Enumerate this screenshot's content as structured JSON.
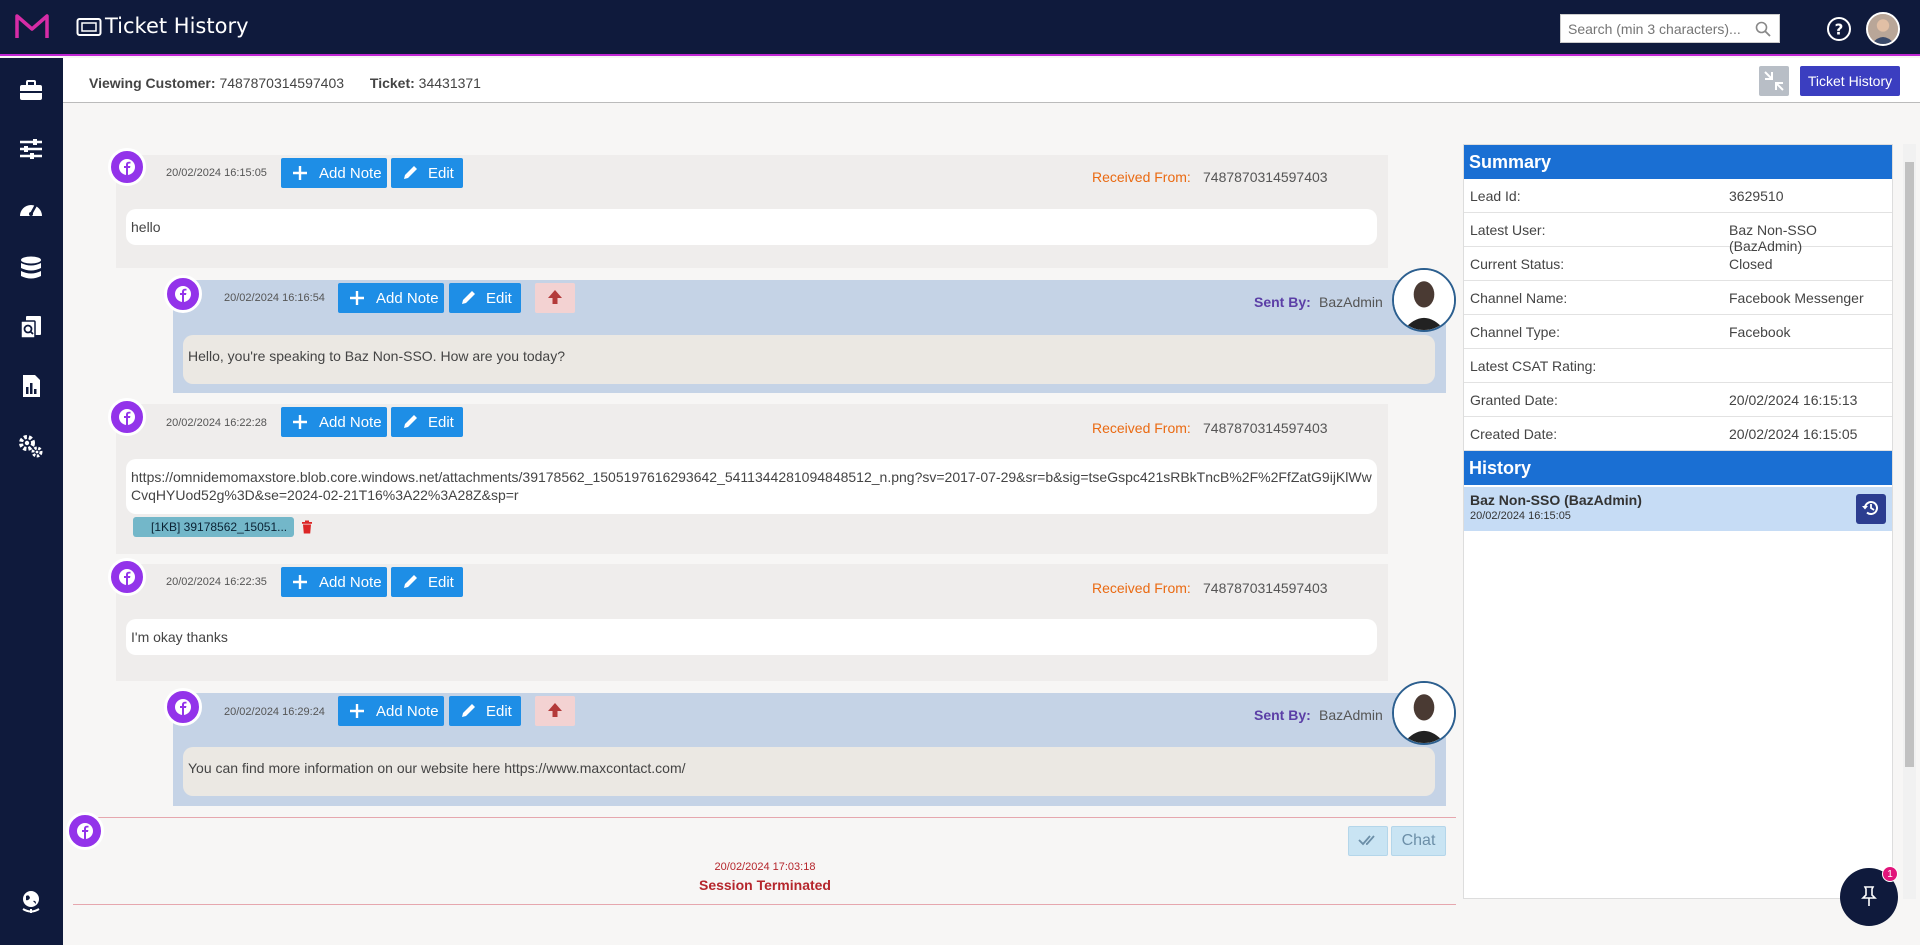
{
  "header": {
    "title": "Ticket History",
    "search_placeholder": "Search (min 3 characters)...",
    "icons": [
      "maxcontact-logo-icon",
      "ticket-icon",
      "search-icon",
      "help-icon",
      "avatar"
    ]
  },
  "sidebar": {
    "icons": [
      "briefcase-icon",
      "sliders-icon",
      "dashboard-icon",
      "database-icon",
      "documents-icon",
      "report-icon",
      "settings-icon",
      "globe-icon"
    ]
  },
  "subheader": {
    "viewing_label": "Viewing Customer:",
    "viewing_value": "7487870314597403",
    "ticket_label": "Ticket:",
    "ticket_value": "34431371",
    "ticket_history_button": "Ticket History"
  },
  "actions": {
    "add_note": "Add Note",
    "edit": "Edit"
  },
  "messages": [
    {
      "direction": "in",
      "timestamp": "20/02/2024 16:15:05",
      "from_label": "Received From:",
      "from_value": "7487870314597403",
      "text": "hello"
    },
    {
      "direction": "out",
      "timestamp": "20/02/2024 16:16:54",
      "from_label": "Sent By:",
      "from_value": "BazAdmin",
      "text": "Hello, you're speaking to Baz Non-SSO. How are you today?"
    },
    {
      "direction": "in",
      "timestamp": "20/02/2024 16:22:28",
      "from_label": "Received From:",
      "from_value": "7487870314597403",
      "text": "https://omnidemomaxstore.blob.core.windows.net/attachments/39178562_1505197616293642_5411344281094848512_n.png?sv=2017-07-29&sr=b&sig=tseGspc421sRBkTncB%2F%2FfZatG9ijKlWwCvqHYUod52g%3D&se=2024-02-21T16%3A22%3A28Z&sp=r",
      "attachment": "[1KB] 39178562_15051..."
    },
    {
      "direction": "in",
      "timestamp": "20/02/2024 16:22:35",
      "from_label": "Received From:",
      "from_value": "7487870314597403",
      "text": "I'm okay thanks"
    },
    {
      "direction": "out",
      "timestamp": "20/02/2024 16:29:24",
      "from_label": "Sent By:",
      "from_value": "BazAdmin",
      "text": "You can find more information on our website here https://www.maxcontact.com/"
    }
  ],
  "session": {
    "date": "20/02/2024 17:03:18",
    "status": "Session Terminated",
    "chat_button": "Chat"
  },
  "summary": {
    "title": "Summary",
    "rows": [
      {
        "key": "Lead Id:",
        "value": "3629510"
      },
      {
        "key": "Latest User:",
        "value": "Baz Non-SSO (BazAdmin)"
      },
      {
        "key": "Current Status:",
        "value": "Closed"
      },
      {
        "key": "Channel Name:",
        "value": "Facebook Messenger"
      },
      {
        "key": "Channel Type:",
        "value": "Facebook"
      },
      {
        "key": "Latest CSAT Rating:",
        "value": ""
      },
      {
        "key": "Granted Date:",
        "value": "20/02/2024 16:15:13"
      },
      {
        "key": "Created Date:",
        "value": "20/02/2024 16:15:05"
      }
    ]
  },
  "history": {
    "title": "History",
    "items": [
      {
        "name": "Baz Non-SSO (BazAdmin)",
        "date": "20/02/2024 16:15:05"
      }
    ]
  },
  "pin": {
    "badge": "1"
  },
  "colors": {
    "nav": "#0f1a3c",
    "accent": "#c026d3",
    "primary_button": "#1e8ee6",
    "received_label": "#ea6a12",
    "sent_label": "#5b3ea6",
    "facebook_badge": "#9333ea",
    "panel_header": "#1a6fd3",
    "terminated": "#b5262c"
  }
}
